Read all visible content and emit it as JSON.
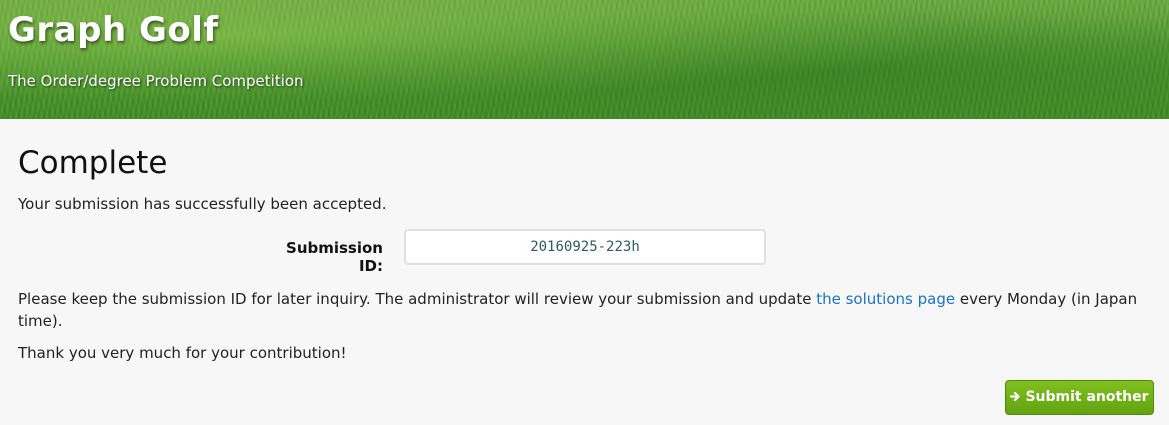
{
  "header": {
    "title": "Graph Golf",
    "subtitle": "The Order/degree Problem Competition"
  },
  "main": {
    "heading": "Complete",
    "accepted_text": "Your submission has successfully been accepted.",
    "submission_id_label": "Submission ID:",
    "submission_id_value": "20160925-223h",
    "keep_text_before": "Please keep the submission ID for later inquiry. The administrator will review your submission and update ",
    "solutions_link_text": "the solutions page",
    "keep_text_after": " every Monday (in Japan time).",
    "thanks_text": "Thank you very much for your contribution!"
  },
  "actions": {
    "submit_another_label": "Submit another",
    "submit_another_icon": "arrow-right-icon",
    "accent_color": "#6aaa14"
  },
  "colors": {
    "link": "#1a73c8",
    "banner_green": "#4e9a2c"
  }
}
